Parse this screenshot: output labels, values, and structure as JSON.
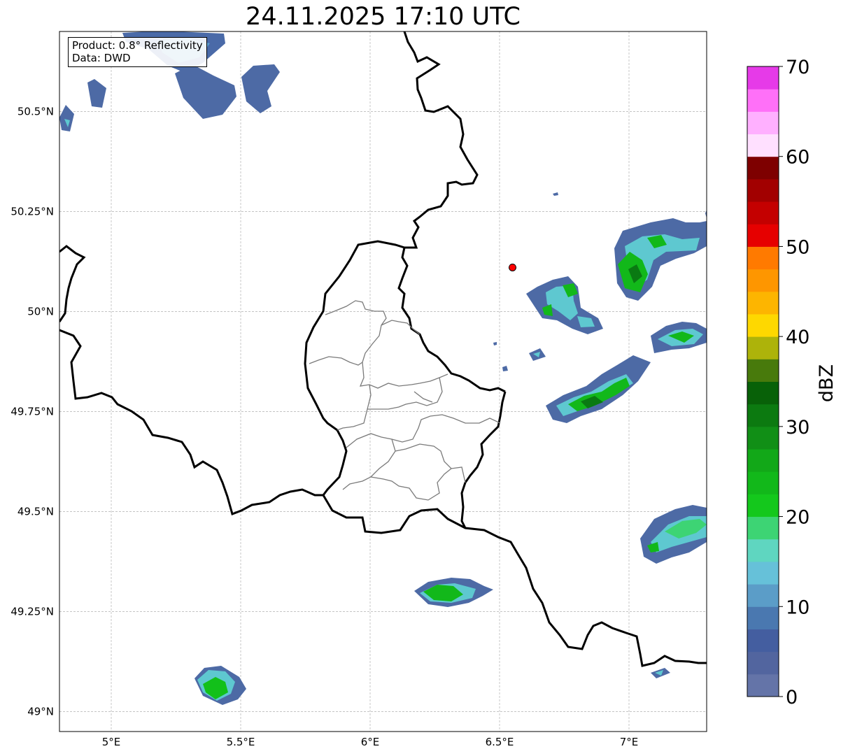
{
  "title": "24.11.2025 17:10 UTC",
  "info": {
    "product": "Product: 0.8° Reflectivity",
    "source": "Data: DWD"
  },
  "map": {
    "lon_range": [
      4.8,
      7.3
    ],
    "lat_range": [
      48.95,
      50.7
    ],
    "lon_ticks": [
      {
        "value": 5.0,
        "label": "5°E"
      },
      {
        "value": 5.5,
        "label": "5.5°E"
      },
      {
        "value": 6.0,
        "label": "6°E"
      },
      {
        "value": 6.5,
        "label": "6.5°E"
      },
      {
        "value": 7.0,
        "label": "7°E"
      }
    ],
    "lat_ticks": [
      {
        "value": 49.0,
        "label": "49°N"
      },
      {
        "value": 49.25,
        "label": "49.25°N"
      },
      {
        "value": 49.5,
        "label": "49.5°N"
      },
      {
        "value": 49.75,
        "label": "49.75°N"
      },
      {
        "value": 50.0,
        "label": "50°N"
      },
      {
        "value": 50.25,
        "label": "50.25°N"
      },
      {
        "value": 50.5,
        "label": "50.5°N"
      }
    ],
    "grid": true,
    "radar_site": {
      "lon": 6.55,
      "lat": 50.11,
      "color": "#ff0000"
    }
  },
  "colorbar": {
    "label": "dBZ",
    "min": 0,
    "max": 70,
    "tick_values": [
      0,
      10,
      20,
      30,
      40,
      50,
      60,
      70
    ],
    "colors": [
      "#6474a8",
      "#52659f",
      "#445ea0",
      "#4a78b0",
      "#5b9dc8",
      "#66c1d9",
      "#5fd6c0",
      "#3dd474",
      "#14c81c",
      "#12b81a",
      "#12a818",
      "#118f16",
      "#0c7a10",
      "#086108",
      "#487a0c",
      "#adb30a",
      "#fed800",
      "#fdb500",
      "#fe9600",
      "#ff7a00",
      "#e60000",
      "#c40000",
      "#a20000",
      "#7e0000",
      "#ffe0ff",
      "#ffb0ff",
      "#ff70f8",
      "#e63ae8"
    ]
  },
  "echo_legend": {
    "blue": "#4a6aa8",
    "cyan": "#5ec8d0",
    "green": "#12c01a",
    "darkgreen": "#0a7a12"
  }
}
